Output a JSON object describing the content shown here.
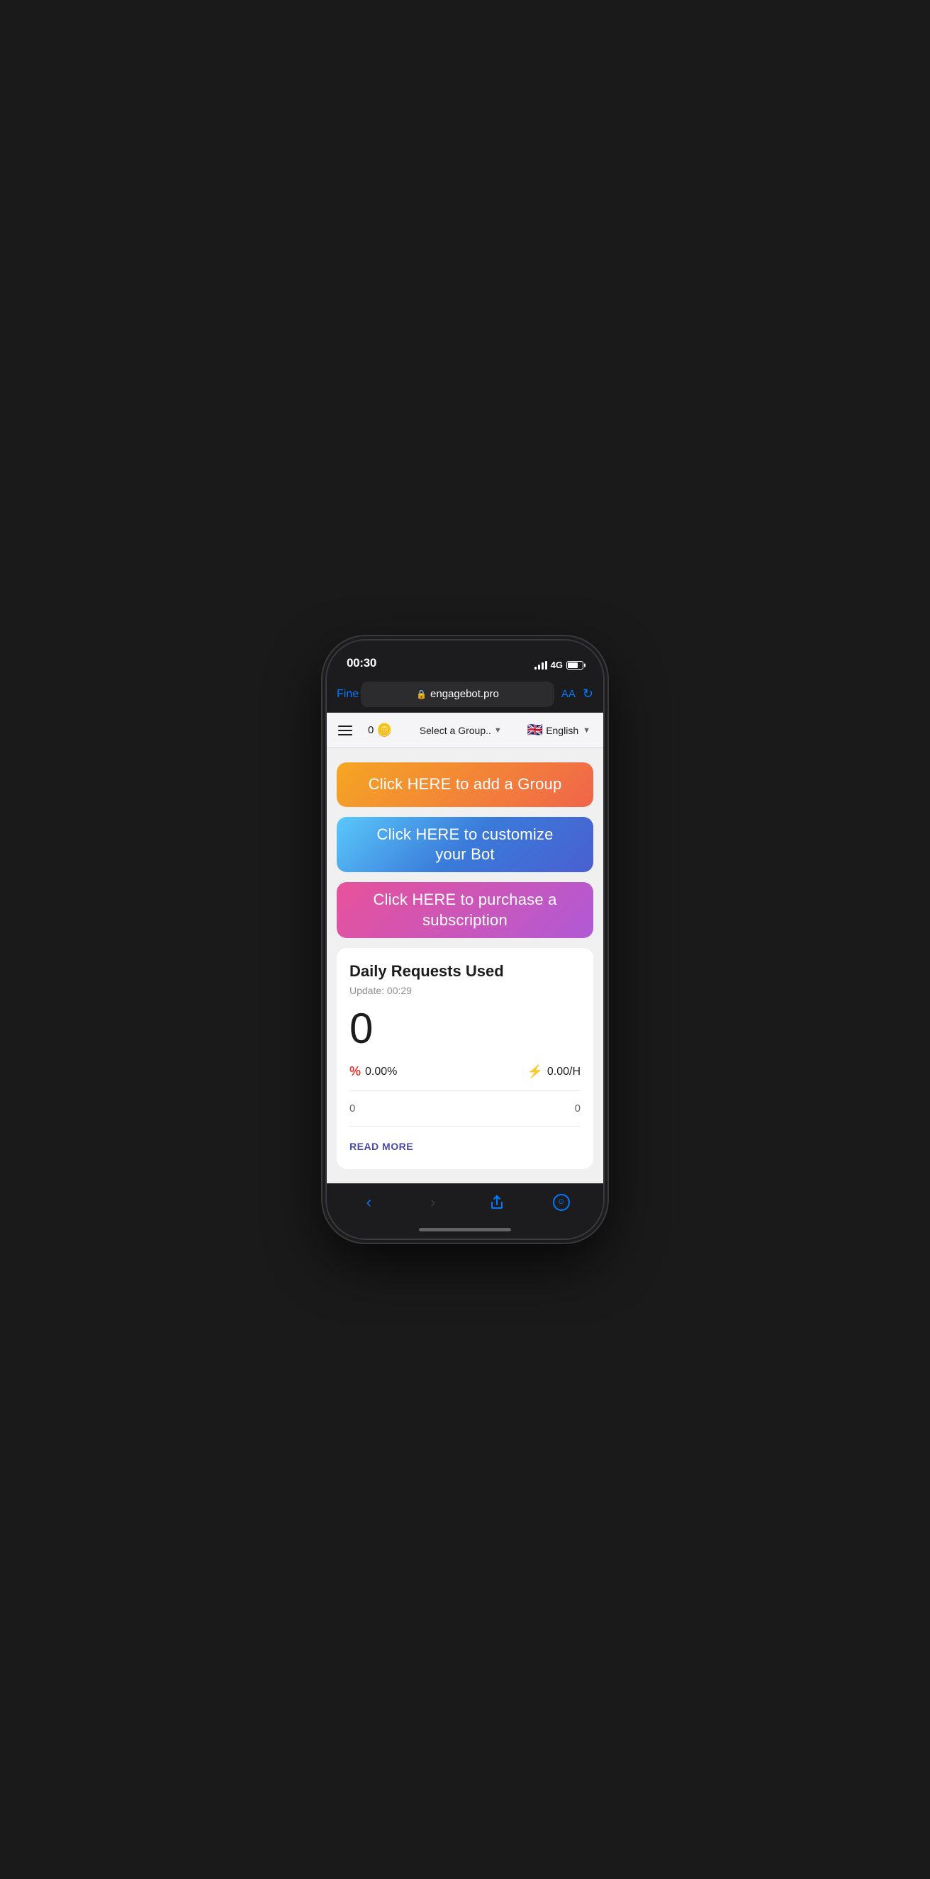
{
  "statusBar": {
    "time": "00:30",
    "network": "4G"
  },
  "browserBar": {
    "url": "engagebot.pro",
    "backLabel": "Fine",
    "aaLabel": "AA"
  },
  "toolbar": {
    "creditsCount": "0",
    "groupSelectPlaceholder": "Select a Group..",
    "languageFlag": "🇬🇧",
    "languageLabel": "English"
  },
  "actions": {
    "addGroup": "Click HERE to add a Group",
    "customizeBot": "Click HERE to customize\nyour Bot",
    "subscription": "Click HERE to purchase a\nsubscription"
  },
  "statsCard": {
    "title": "Daily Requests Used",
    "updateLabel": "Update: 00:29",
    "count": "0",
    "percentValue": "0.00%",
    "hourlyValue": "0.00/H",
    "leftCount": "0",
    "rightCount": "0",
    "readMore": "READ MORE"
  }
}
